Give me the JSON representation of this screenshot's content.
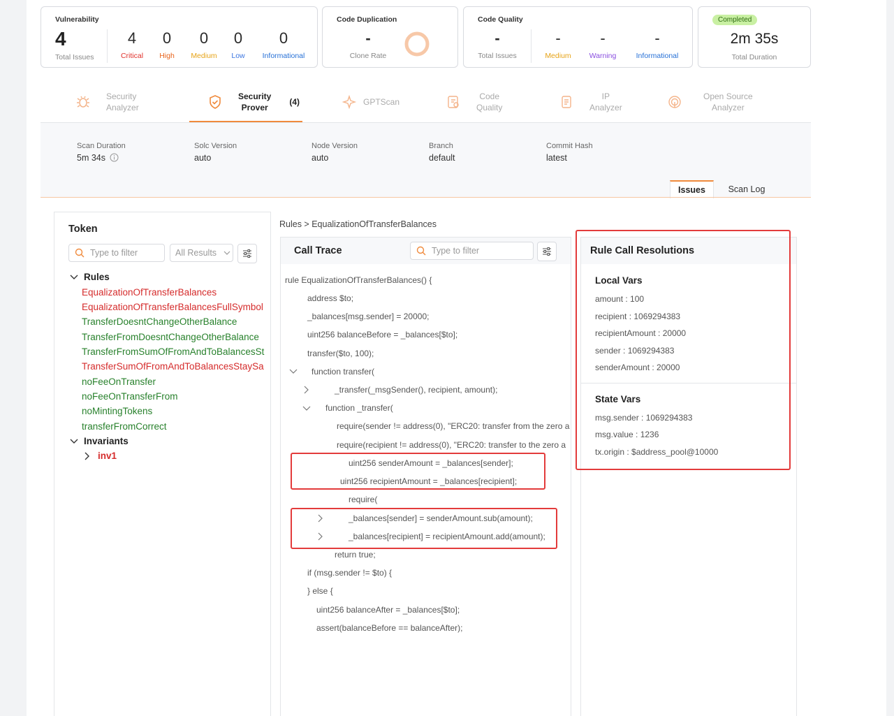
{
  "summary": {
    "vulnerability": {
      "title": "Vulnerability",
      "total": "4",
      "total_label": "Total Issues",
      "items": [
        {
          "value": "4",
          "label": "Critical",
          "color": "#e0312b"
        },
        {
          "value": "0",
          "label": "High",
          "color": "#e8641c"
        },
        {
          "value": "0",
          "label": "Medium",
          "color": "#e6a317"
        },
        {
          "value": "0",
          "label": "Low",
          "color": "#3c76e0"
        },
        {
          "value": "0",
          "label": "Informational",
          "color": "#2670d6"
        }
      ]
    },
    "duplication": {
      "title": "Code Duplication",
      "value": "-",
      "label": "Clone Rate"
    },
    "quality": {
      "title": "Code Quality",
      "total": "-",
      "total_label": "Total Issues",
      "items": [
        {
          "value": "-",
          "label": "Medium",
          "color": "#e6a317"
        },
        {
          "value": "-",
          "label": "Warning",
          "color": "#8a4fe0"
        },
        {
          "value": "-",
          "label": "Informational",
          "color": "#2670d6"
        }
      ]
    },
    "status": {
      "badge": "Completed",
      "duration": "2m 35s",
      "label": "Total Duration"
    }
  },
  "tabs": [
    {
      "line1": "Security",
      "line2": "Analyzer",
      "icon": "bug-icon"
    },
    {
      "line1": "Security",
      "line2": "Prover",
      "count": "(4)",
      "icon": "shield-icon",
      "active": true
    },
    {
      "line1": "GPTScan",
      "line2": "",
      "icon": "sparkle-icon"
    },
    {
      "line1": "Code",
      "line2": "Quality",
      "icon": "code-file-icon"
    },
    {
      "line1": "IP",
      "line2": "Analyzer",
      "icon": "document-icon"
    },
    {
      "line1": "Open Source",
      "line2": "Analyzer",
      "icon": "radar-icon"
    }
  ],
  "meta": [
    {
      "label": "Scan Duration",
      "value": "5m 34s"
    },
    {
      "label": "Solc Version",
      "value": "auto"
    },
    {
      "label": "Node Version",
      "value": "auto"
    },
    {
      "label": "Branch",
      "value": "default"
    },
    {
      "label": "Commit Hash",
      "value": "latest"
    }
  ],
  "subtabs": {
    "issues": "Issues",
    "scan_log": "Scan Log"
  },
  "token": {
    "title": "Token",
    "filter_placeholder": "Type to filter",
    "results_select": "All Results",
    "rules_label": "Rules",
    "rules": [
      {
        "name": "EqualizationOfTransferBalances",
        "status": "fail"
      },
      {
        "name": "EqualizationOfTransferBalancesFullSymbol",
        "status": "fail"
      },
      {
        "name": "TransferDoesntChangeOtherBalance",
        "status": "pass"
      },
      {
        "name": "TransferFromDoesntChangeOtherBalance",
        "status": "pass"
      },
      {
        "name": "TransferFromSumOfFromAndToBalancesSt",
        "status": "pass"
      },
      {
        "name": "TransferSumOfFromAndToBalancesStaySa",
        "status": "fail"
      },
      {
        "name": "noFeeOnTransfer",
        "status": "pass"
      },
      {
        "name": "noFeeOnTransferFrom",
        "status": "pass"
      },
      {
        "name": "noMintingTokens",
        "status": "pass"
      },
      {
        "name": "transferFromCorrect",
        "status": "pass"
      }
    ],
    "invariants_label": "Invariants",
    "invariants": [
      {
        "name": "inv1",
        "status": "fail"
      }
    ]
  },
  "breadcrumb": "Rules > EqualizationOfTransferBalances",
  "call_trace": {
    "title": "Call Trace",
    "filter_placeholder": "Type to filter",
    "lines": [
      "rule EqualizationOfTransferBalances() {",
      "address $to;",
      "_balances[msg.sender] = 20000;",
      "uint256 balanceBefore = _balances[$to];",
      "transfer($to, 100);",
      "function transfer(",
      "_transfer(_msgSender(), recipient, amount);",
      "function _transfer(",
      "require(sender != address(0), \"ERC20: transfer from the zero a",
      "require(recipient != address(0), \"ERC20: transfer to the zero a",
      "uint256 senderAmount = _balances[sender];",
      "uint256 recipientAmount = _balances[recipient];",
      "require(",
      "_balances[sender] = senderAmount.sub(amount);",
      "_balances[recipient] = recipientAmount.add(amount);",
      "return true;",
      "if (msg.sender != $to) {",
      "} else {",
      "uint256 balanceAfter = _balances[$to];",
      "assert(balanceBefore == balanceAfter);"
    ]
  },
  "resolutions": {
    "title": "Rule Call Resolutions",
    "local_title": "Local Vars",
    "local": [
      "amount : 100",
      "recipient : 1069294383",
      "recipientAmount : 20000",
      "sender : 1069294383",
      "senderAmount : 20000"
    ],
    "state_title": "State Vars",
    "state": [
      "msg.sender : 1069294383",
      "msg.value : 1236",
      "tx.origin : $address_pool@10000"
    ]
  },
  "colors": {
    "accent": "#f08a3c",
    "highlight": "#e33b3b",
    "fail": "#d52c2c",
    "pass": "#28812c"
  }
}
